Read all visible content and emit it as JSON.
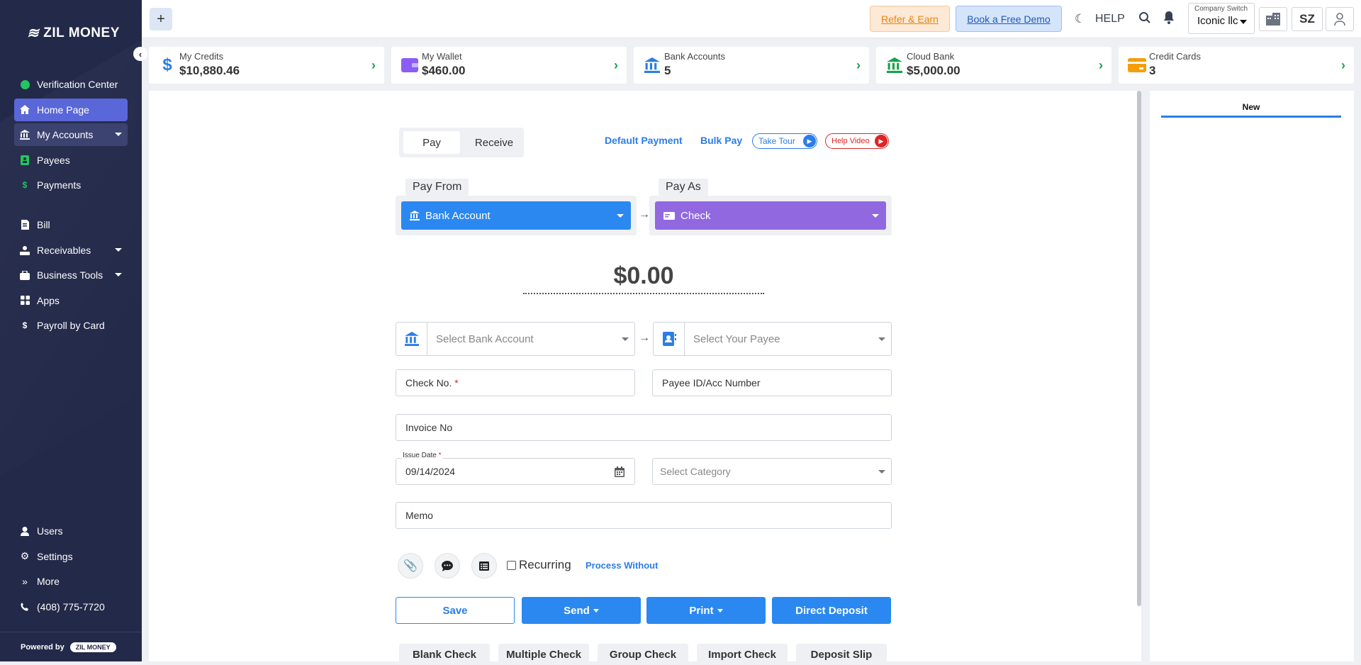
{
  "brand": {
    "name": "ZIL MONEY",
    "powered_by": "Powered by",
    "powered_pill": "ZIL MONEY"
  },
  "sidebar": {
    "items": [
      {
        "label": "Verification Center",
        "icon": "check-circle-icon"
      },
      {
        "label": "Home Page",
        "icon": "home-icon"
      },
      {
        "label": "My Accounts",
        "icon": "bank-icon"
      },
      {
        "label": "Payees",
        "icon": "payee-icon"
      },
      {
        "label": "Payments",
        "icon": "dollar-icon"
      },
      {
        "label": "Bill",
        "icon": "bill-icon"
      },
      {
        "label": "Receivables",
        "icon": "receivables-icon"
      },
      {
        "label": "Business Tools",
        "icon": "briefcase-icon"
      },
      {
        "label": "Apps",
        "icon": "apps-icon"
      },
      {
        "label": "Payroll by Card",
        "icon": "dollar-icon"
      }
    ],
    "bottom": [
      {
        "label": "Users"
      },
      {
        "label": "Settings"
      },
      {
        "label": "More"
      },
      {
        "label": "(408) 775-7720"
      }
    ]
  },
  "topbar": {
    "refer": "Refer & Earn",
    "demo": "Book a Free Demo",
    "help": "HELP",
    "company_label": "Company Switch",
    "company_value": "Iconic llc",
    "user_initials": "SZ"
  },
  "summary": [
    {
      "title": "My Credits",
      "value": "$10,880.46",
      "color": "#2b7de9"
    },
    {
      "title": "My Wallet",
      "value": "$460.00",
      "color": "#8b5cf6"
    },
    {
      "title": "Bank Accounts",
      "value": "5",
      "color": "#2b7de9"
    },
    {
      "title": "Cloud Bank",
      "value": "$5,000.00",
      "color": "#16a34a"
    },
    {
      "title": "Credit Cards",
      "value": "3",
      "color": "#f59e0b"
    }
  ],
  "payment": {
    "tab_pay": "Pay",
    "tab_receive": "Receive",
    "default_payment": "Default Payment",
    "bulk_pay": "Bulk Pay",
    "take_tour": "Take Tour",
    "help_video": "Help Video",
    "pay_from_label": "Pay From",
    "pay_from_value": "Bank Account",
    "pay_as_label": "Pay As",
    "pay_as_value": "Check",
    "amount": "$0.00",
    "select_bank": "Select Bank Account",
    "select_payee": "Select Your Payee",
    "check_no": "Check No.",
    "payee_id": "Payee ID/Acc Number",
    "invoice": "Invoice No",
    "issue_date_label": "Issue Date",
    "issue_date": "09/14/2024",
    "category": "Select Category",
    "memo": "Memo",
    "recurring": "Recurring",
    "process_without": "Process Without",
    "save": "Save",
    "send": "Send",
    "print": "Print",
    "direct_deposit": "Direct Deposit",
    "bottom_tabs": [
      "Blank Check",
      "Multiple Check",
      "Group Check",
      "Import Check",
      "Deposit Slip"
    ]
  },
  "right_panel": {
    "tab": "New"
  }
}
